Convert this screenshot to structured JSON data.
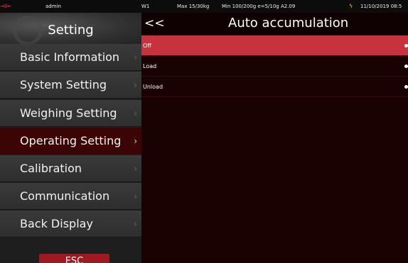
{
  "status_bar": {
    "zero_indicator": "→0←",
    "user": "admin",
    "scale": "W1",
    "max": "Max 15/30kg",
    "min": "Min 100/200g e=5/10g A2.09",
    "date": "11/10/2019 08:5"
  },
  "sidebar": {
    "title": "Setting",
    "items": [
      {
        "label": "Basic Information",
        "active": false
      },
      {
        "label": "System Setting",
        "active": false
      },
      {
        "label": "Weighing Setting",
        "active": false
      },
      {
        "label": "Operating Setting",
        "active": true
      },
      {
        "label": "Calibration",
        "active": false
      },
      {
        "label": "Communication",
        "active": false
      },
      {
        "label": "Back Display",
        "active": false
      }
    ],
    "chevron": "›",
    "esc_label": "ESC"
  },
  "main": {
    "back_label": "<<",
    "title": "Auto accumulation",
    "options": [
      {
        "label": "Off",
        "selected": true
      },
      {
        "label": "Load",
        "selected": false
      },
      {
        "label": "Unload",
        "selected": false
      }
    ]
  },
  "colors": {
    "accent": "#c8323c",
    "active_menu": "#3b0505",
    "background": "#1a0202"
  }
}
